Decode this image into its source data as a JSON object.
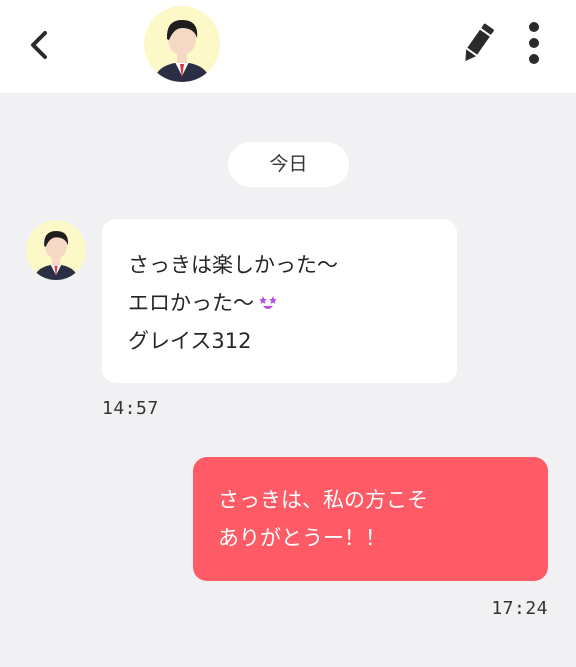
{
  "header": {
    "back_icon": "chevron-left-icon",
    "contact_name": "",
    "edit_icon": "pencil-icon",
    "more_icon": "vertical-dots-icon"
  },
  "chat": {
    "date_divider": "今日",
    "messages": [
      {
        "direction": "incoming",
        "lines": [
          "さっきは楽しかった〜",
          "エロかった〜",
          "グレイス312"
        ],
        "emoji": "starry-eyed-face-icon",
        "time": "14:57"
      },
      {
        "direction": "outgoing",
        "lines": [
          "さっきは、私の方こそ",
          "ありがとうー！！"
        ],
        "time": "17:24"
      }
    ]
  },
  "colors": {
    "background": "#f1f1f3",
    "header_background": "#ffffff",
    "incoming_bubble": "#ffffff",
    "outgoing_bubble": "#ff5b67",
    "avatar_background": "#fdf8c8",
    "emoji_color": "#c04be0"
  }
}
